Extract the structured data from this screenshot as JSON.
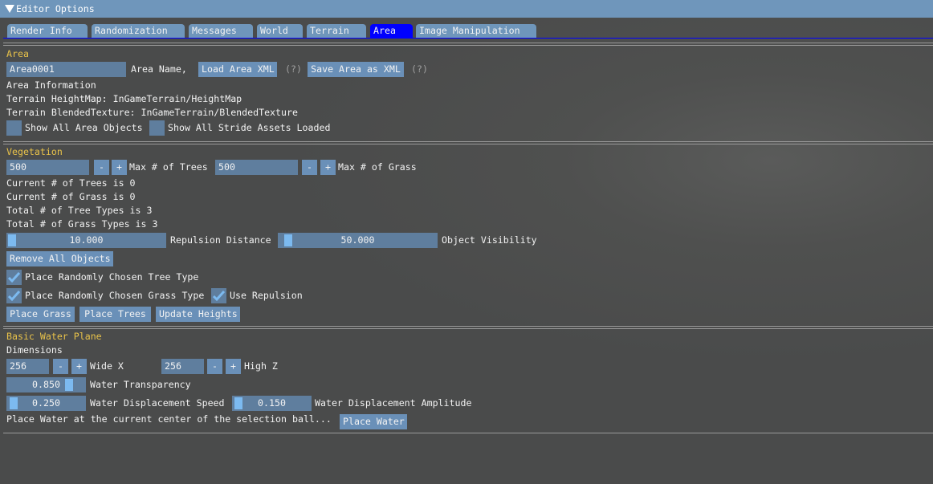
{
  "window": {
    "title": "Editor Options",
    "collapse_icon": "triangle-down"
  },
  "tabs": [
    "Render Info",
    "Randomization",
    "Messages",
    "World",
    "Terrain",
    "Area",
    "Image Manipulation"
  ],
  "active_tab": "Area",
  "colors": {
    "title_bar": "#6f96bb",
    "active_tab": "#0000ff",
    "header": "#e8c24a",
    "frame": "#5f7e9e",
    "button": "#6a90b8",
    "slider_grab": "#7cbaf0"
  },
  "area": {
    "header": "Area",
    "name_value": "Area0001",
    "name_label": "Area Name,",
    "load_button": "Load Area XML",
    "save_button": "Save Area as XML",
    "help": "(?)",
    "info_title": "Area Information",
    "heightmap": "Terrain HeightMap: InGameTerrain/HeightMap",
    "texture": "Terrain BlendedTexture: InGameTerrain/BlendedTexture",
    "show_objects": {
      "label": "Show All Area Objects",
      "checked": false
    },
    "show_assets": {
      "label": "Show All Stride Assets Loaded",
      "checked": false
    }
  },
  "vegetation": {
    "header": "Vegetation",
    "max_trees": {
      "value": "500",
      "label": "Max # of Trees"
    },
    "max_grass": {
      "value": "500",
      "label": "Max # of Grass"
    },
    "minus": "-",
    "plus": "+",
    "current_trees": "Current # of Trees is 0",
    "current_grass": "Current # of Grass is 0",
    "tree_types": "Total # of Tree Types is 3",
    "grass_types": "Total # of Grass Types is 3",
    "repulsion": {
      "value": "10.000",
      "label": "Repulsion Distance"
    },
    "visibility": {
      "value": "50.000",
      "label": "Object Visibility"
    },
    "remove_button": "Remove All Objects",
    "random_tree": {
      "label": "Place Randomly Chosen Tree Type",
      "checked": true
    },
    "random_grass": {
      "label": "Place Randomly Chosen Grass Type",
      "checked": true
    },
    "use_repulsion": {
      "label": "Use Repulsion",
      "checked": true
    },
    "place_grass": "Place Grass",
    "place_trees": "Place Trees",
    "update_heights": "Update Heights"
  },
  "water": {
    "header": "Basic Water Plane",
    "dimensions": "Dimensions",
    "wide": {
      "value": "256",
      "label": "Wide X"
    },
    "high": {
      "value": "256",
      "label": "High Z"
    },
    "transparency": {
      "value": "0.850",
      "label": "Water Transparency"
    },
    "speed": {
      "value": "0.250",
      "label": "Water Displacement Speed"
    },
    "amplitude": {
      "value": "0.150",
      "label": "Water Displacement Amplitude"
    },
    "place_text": "Place Water at the current center of the selection ball...",
    "place_button": "Place Water"
  }
}
